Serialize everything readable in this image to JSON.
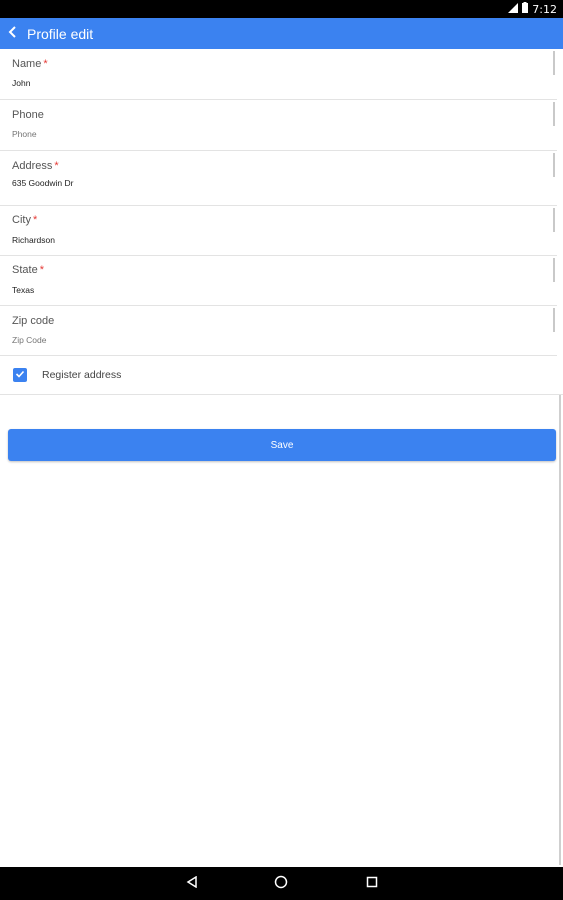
{
  "status_bar": {
    "time": "7:12"
  },
  "app_bar": {
    "title": "Profile edit"
  },
  "form": {
    "name": {
      "label": "Name",
      "required": "*",
      "value": "John"
    },
    "phone": {
      "label": "Phone",
      "placeholder": "Phone"
    },
    "address": {
      "label": "Address",
      "required": "*",
      "value": "635 Goodwin Dr"
    },
    "city": {
      "label": "City",
      "required": "*",
      "value": "Richardson"
    },
    "state": {
      "label": "State",
      "required": "*",
      "value": "Texas"
    },
    "zip": {
      "label": "Zip code",
      "placeholder": "Zip Code"
    },
    "register_address": {
      "label": "Register address",
      "checked": true
    }
  },
  "save_button": {
    "label": "Save"
  },
  "colors": {
    "primary": "#3b82f0",
    "required": "#e53935"
  },
  "icons": {
    "back": "back-arrow-icon",
    "checkbox": "check-icon",
    "nav_back": "triangle-back-icon",
    "nav_home": "circle-home-icon",
    "nav_recents": "square-recents-icon"
  }
}
